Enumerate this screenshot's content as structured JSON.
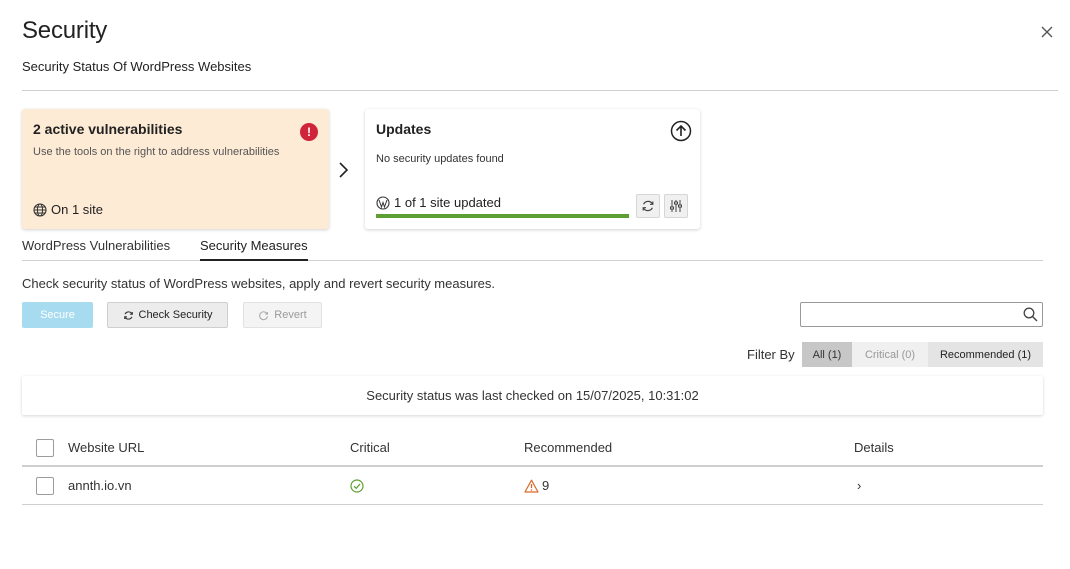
{
  "header": {
    "title": "Security",
    "subtitle": "Security Status Of WordPress Websites",
    "close_glyph": "×"
  },
  "vulnerabilities_card": {
    "heading": "2 active vulnerabilities",
    "description": "Use the tools on the right to address vulnerabilities",
    "site_count": "On 1 site",
    "alert_glyph": "!",
    "background_color": "#fdebd6",
    "alert_color": "#d0243a"
  },
  "updates_card": {
    "heading": "Updates",
    "description": "No security updates found",
    "status": "1 of 1 site updated",
    "progress_fraction": 1.0,
    "progress_color": "#5ca034"
  },
  "tabs": [
    {
      "label": "WordPress Vulnerabilities",
      "active": false
    },
    {
      "label": "Security Measures",
      "active": true
    }
  ],
  "intro_text": "Check security status of WordPress websites, apply and revert security measures.",
  "toolbar": {
    "secure_label": "Secure",
    "check_label": "Check Security",
    "revert_label": "Revert",
    "search_placeholder": ""
  },
  "filter": {
    "label": "Filter By",
    "options": [
      "All (1)",
      "Critical (0)",
      "Recommended (1)"
    ],
    "selected": "All (1)"
  },
  "banner": {
    "text": "Security status was last checked on 15/07/2025, 10:31:02"
  },
  "table": {
    "headers": {
      "url": "Website URL",
      "critical": "Critical",
      "recommended": "Recommended",
      "details": "Details"
    },
    "rows": [
      {
        "url": "annth.io.vn",
        "critical_icon": "check-circle-icon",
        "recommended_count": "9",
        "details_glyph": "›"
      }
    ]
  },
  "icons": {
    "close": "close-icon",
    "alert": "alert-circle-icon",
    "globe": "globe-icon",
    "next": "chevron-right-icon",
    "upload": "upload-circle-icon",
    "wordpress": "wordpress-icon",
    "refresh": "refresh-icon",
    "settings": "sliders-icon",
    "search": "search-icon",
    "warning": "warning-triangle-icon"
  }
}
